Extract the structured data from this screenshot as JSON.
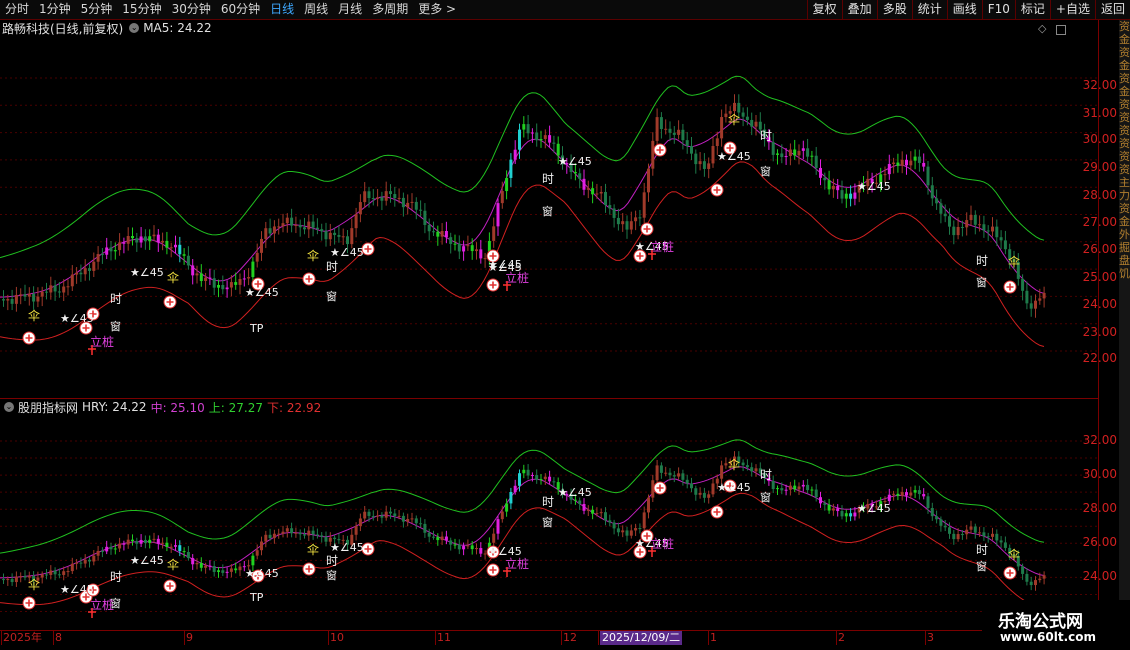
{
  "toolbar": {
    "periods": [
      "分时",
      "1分钟",
      "5分钟",
      "15分钟",
      "30分钟",
      "60分钟",
      "日线",
      "周线",
      "月线",
      "多周期",
      "更多 >"
    ],
    "active_period": "日线",
    "right_buttons": [
      "复权",
      "叠加",
      "多股",
      "统计",
      "画线",
      "F10",
      "标记",
      "+自选",
      "返回"
    ]
  },
  "main_pane": {
    "stock_title": "路畅科技(日线,前复权)",
    "indicator": "MA5: 24.22",
    "y_labels": [
      "32.00",
      "31.00",
      "30.00",
      "29.00",
      "28.00",
      "27.00",
      "26.00",
      "25.00",
      "24.00",
      "23.00",
      "22.00"
    ],
    "annotations": {
      "star": "★∠45",
      "time": "时",
      "window": "窗",
      "umbrella": "伞",
      "pile": "立桩",
      "tp": "TP"
    }
  },
  "sub_pane": {
    "indicator_name": "股朋指标网",
    "hry": "HRY: 24.22",
    "mid": "中: 25.10",
    "upper": "上: 27.27",
    "lower": "下: 22.92",
    "y_labels": [
      "32.00",
      "30.00",
      "28.00",
      "26.00",
      "24.00"
    ]
  },
  "xaxis": {
    "labels": [
      "2025年",
      "8",
      "9",
      "10",
      "11",
      "12",
      "2025/12/09/二",
      "1",
      "2",
      "3"
    ]
  },
  "sidebar_chars": [
    "资",
    "金",
    "资",
    "金",
    "资",
    "金",
    "资",
    "资",
    "资",
    "资",
    "资",
    "资",
    "主",
    "力",
    "资",
    "金",
    "外",
    "掘",
    "盘",
    "饥"
  ],
  "watermark": {
    "line1": "乐淘公式网",
    "line2": "www.60lt.com"
  },
  "colors": {
    "background": "#000000",
    "grid": "#7a0000",
    "up_candle": "#a03a2a",
    "down_candle": "#1e7a4a",
    "magenta_bar": "#e020e0",
    "green_bar": "#20d020",
    "upper_band": "#20c020",
    "mid_band": "#c020c0",
    "lower_band": "#d02020",
    "active_tab": "#3ea8ff"
  }
}
